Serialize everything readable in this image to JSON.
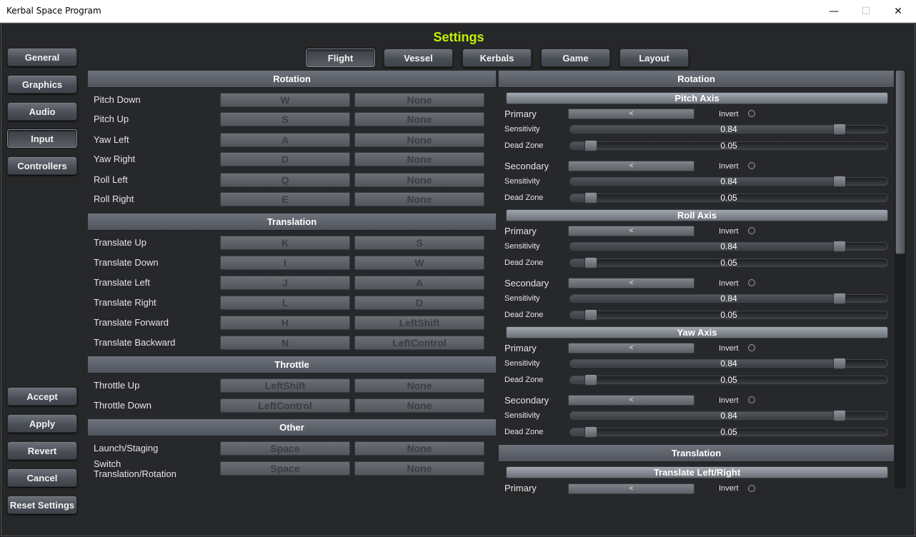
{
  "window": {
    "title": "Kerbal Space Program",
    "minimize_glyph": "—",
    "maximize_glyph": "☐",
    "close_glyph": "✕"
  },
  "settings_title": "Settings",
  "sidebar": {
    "general": "General",
    "graphics": "Graphics",
    "audio": "Audio",
    "input": "Input",
    "controllers": "Controllers",
    "accept": "Accept",
    "apply": "Apply",
    "revert": "Revert",
    "cancel": "Cancel",
    "reset": "Reset Settings"
  },
  "tabs": {
    "flight": "Flight",
    "vessel": "Vessel",
    "kerbals": "Kerbals",
    "game": "Game",
    "layout": "Layout",
    "active": "Flight"
  },
  "left": {
    "rotation": {
      "header": "Rotation",
      "rows": [
        {
          "label": "Pitch Down",
          "primary": "W",
          "secondary": "None"
        },
        {
          "label": "Pitch Up",
          "primary": "S",
          "secondary": "None"
        },
        {
          "label": "Yaw Left",
          "primary": "A",
          "secondary": "None"
        },
        {
          "label": "Yaw Right",
          "primary": "D",
          "secondary": "None"
        },
        {
          "label": "Roll Left",
          "primary": "Q",
          "secondary": "None"
        },
        {
          "label": "Roll Right",
          "primary": "E",
          "secondary": "None"
        }
      ]
    },
    "translation": {
      "header": "Translation",
      "rows": [
        {
          "label": "Translate Up",
          "primary": "K",
          "secondary": "S"
        },
        {
          "label": "Translate Down",
          "primary": "I",
          "secondary": "W"
        },
        {
          "label": "Translate Left",
          "primary": "J",
          "secondary": "A"
        },
        {
          "label": "Translate Right",
          "primary": "L",
          "secondary": "D"
        },
        {
          "label": "Translate Forward",
          "primary": "H",
          "secondary": "LeftShift"
        },
        {
          "label": "Translate Backward",
          "primary": "N",
          "secondary": "LeftControl"
        }
      ]
    },
    "throttle": {
      "header": "Throttle",
      "rows": [
        {
          "label": "Throttle Up",
          "primary": "LeftShift",
          "secondary": "None"
        },
        {
          "label": "Throttle Down",
          "primary": "LeftControl",
          "secondary": "None"
        }
      ]
    },
    "other": {
      "header": "Other",
      "rows": [
        {
          "label": "Launch/Staging",
          "primary": "Space",
          "secondary": "None"
        },
        {
          "label": "Switch\nTranslation/Rotation",
          "primary": "Space",
          "secondary": "None"
        }
      ]
    }
  },
  "right": {
    "rotation_header": "Rotation",
    "translation_header": "Translation",
    "labels": {
      "primary": "Primary",
      "secondary": "Secondary",
      "sensitivity": "Sensitivity",
      "dead_zone": "Dead Zone",
      "invert": "Invert",
      "axis_button": "<"
    },
    "axes": [
      {
        "name": "Pitch Axis",
        "primary": {
          "sensitivity": "0.84",
          "dead_zone": "0.05"
        },
        "secondary": {
          "sensitivity": "0.84",
          "dead_zone": "0.05"
        }
      },
      {
        "name": "Roll Axis",
        "primary": {
          "sensitivity": "0.84",
          "dead_zone": "0.05"
        },
        "secondary": {
          "sensitivity": "0.84",
          "dead_zone": "0.05"
        }
      },
      {
        "name": "Yaw Axis",
        "primary": {
          "sensitivity": "0.84",
          "dead_zone": "0.05"
        },
        "secondary": {
          "sensitivity": "0.84",
          "dead_zone": "0.05"
        }
      }
    ],
    "translate_axis": "Translate Left/Right"
  }
}
